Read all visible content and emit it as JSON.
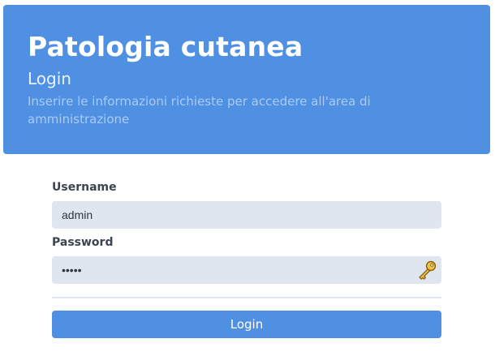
{
  "header": {
    "title": "Patologia cutanea",
    "subtitle": "Login",
    "description": "Inserire le informazioni richieste per accedere all'area di amministrazione"
  },
  "form": {
    "username": {
      "label": "Username",
      "value": "admin"
    },
    "password": {
      "label": "Password",
      "value": "admin",
      "icon": "key-icon"
    },
    "submit_label": "Login"
  },
  "colors": {
    "header_bg": "#4f90e3",
    "input_bg": "#dfe6ef",
    "button_bg": "#4f90e3"
  }
}
